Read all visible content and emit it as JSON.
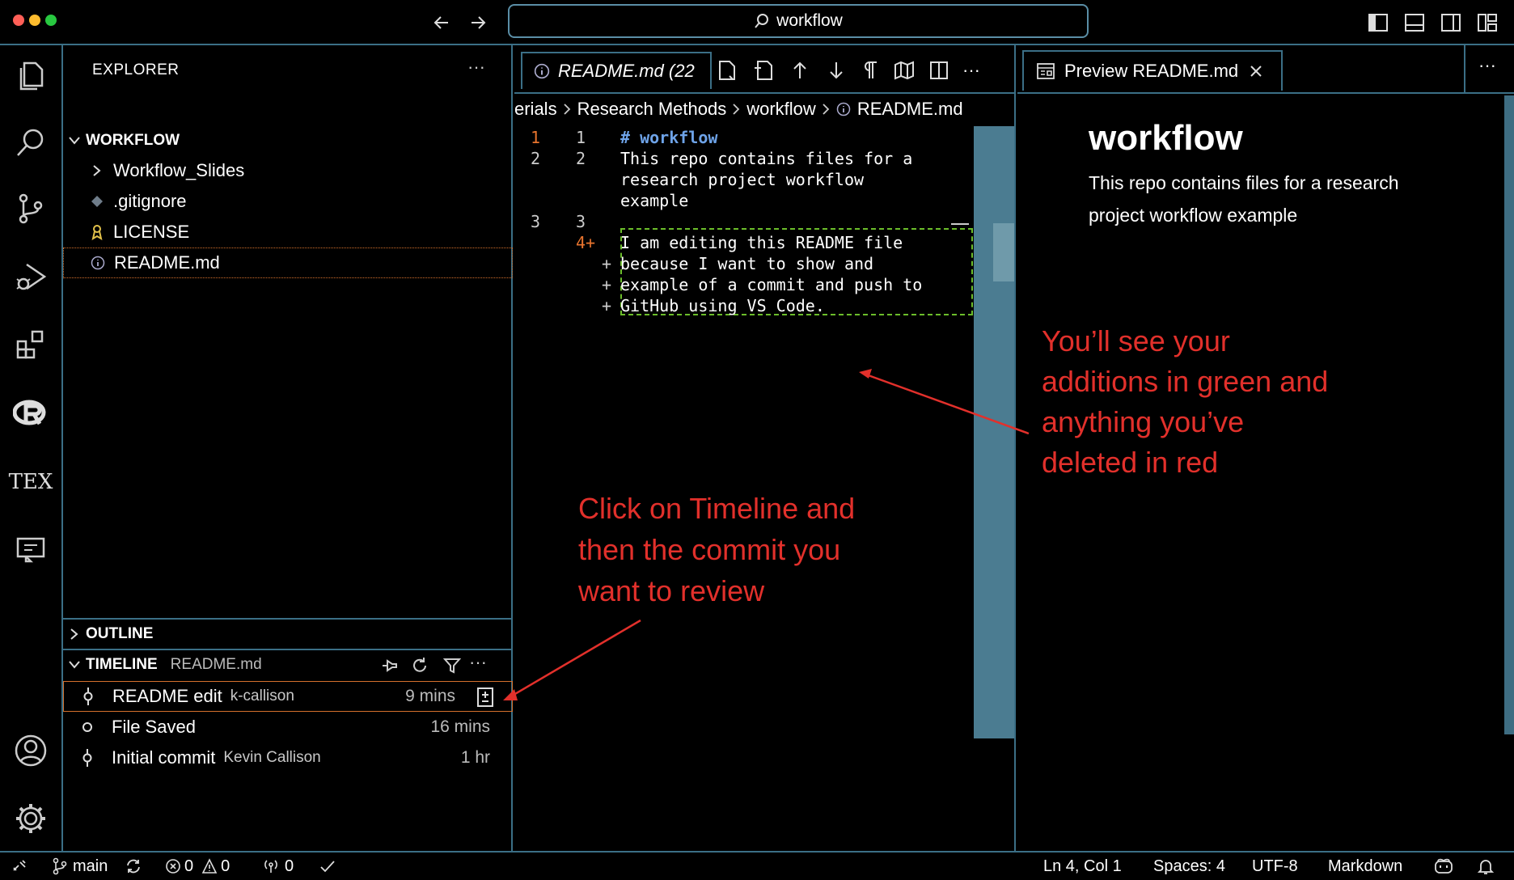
{
  "title_bar": {
    "search_text": "workflow",
    "nav_back": "back",
    "nav_forward": "forward"
  },
  "activity_bar": {
    "items": [
      "explorer",
      "search",
      "source-control",
      "run-debug",
      "extensions",
      "r-lang",
      "tex",
      "remote-explorer"
    ],
    "tex_label": "TEX",
    "bottom": [
      "accounts",
      "settings"
    ]
  },
  "explorer": {
    "title": "EXPLORER",
    "more": "···",
    "folder": "WORKFLOW",
    "items": [
      {
        "label": "Workflow_Slides",
        "icon": "chevron-right-icon"
      },
      {
        "label": ".gitignore",
        "icon": "git-icon"
      },
      {
        "label": "LICENSE",
        "icon": "license-icon"
      },
      {
        "label": "README.md",
        "icon": "info-icon"
      }
    ]
  },
  "outline": {
    "title": "OUTLINE"
  },
  "timeline": {
    "title": "TIMELINE",
    "file": "README.md",
    "more": "···",
    "items": [
      {
        "label": "README edit",
        "author": "k-callison",
        "time": "9 mins"
      },
      {
        "label": "File Saved",
        "author": "",
        "time": "16 mins"
      },
      {
        "label": "Initial commit",
        "author": "Kevin Callison",
        "time": "1 hr"
      }
    ]
  },
  "editor": {
    "tab_label": "README.md (22",
    "more": "···",
    "breadcrumb": [
      "erials",
      "Research Methods",
      "workflow",
      "README.md"
    ],
    "left_lines": [
      "1",
      "2",
      "3"
    ],
    "right_lines": [
      "1",
      "2",
      "3",
      "4+"
    ],
    "plus": "+",
    "code": [
      "# workflow",
      "This repo contains files for a",
      "research project workflow",
      "example",
      "I am editing this README file",
      "because I want to show and",
      "example of a commit and push to",
      "GitHub using VS Code."
    ],
    "added_color": "#6bbd2a"
  },
  "preview": {
    "tab_label": "Preview README.md",
    "more": "···",
    "heading": "workflow",
    "body": "This repo contains files for a research project workflow example"
  },
  "annotations": {
    "right_note": [
      "You’ll see your",
      "additions in green and",
      "anything you’ve",
      "deleted in red"
    ],
    "center_note": [
      "Click on Timeline and",
      "then the commit you",
      "want to review"
    ],
    "color": "#e2302b"
  },
  "status_bar": {
    "branch": "main",
    "errors": "0",
    "warnings": "0",
    "ports": "0",
    "position": "Ln 4, Col 1",
    "spaces": "Spaces: 4",
    "encoding": "UTF-8",
    "language": "Markdown"
  }
}
